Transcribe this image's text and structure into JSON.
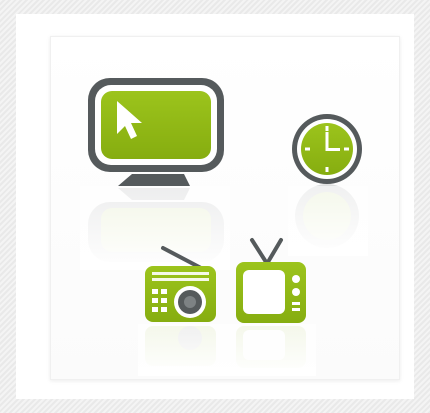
{
  "colors": {
    "accent_green": "#8db414",
    "dark_gray": "#555a5c",
    "background": "#ececec",
    "card": "#ffffff"
  },
  "icons": [
    "computer-monitor-icon",
    "clock-icon",
    "radio-icon",
    "television-icon"
  ]
}
